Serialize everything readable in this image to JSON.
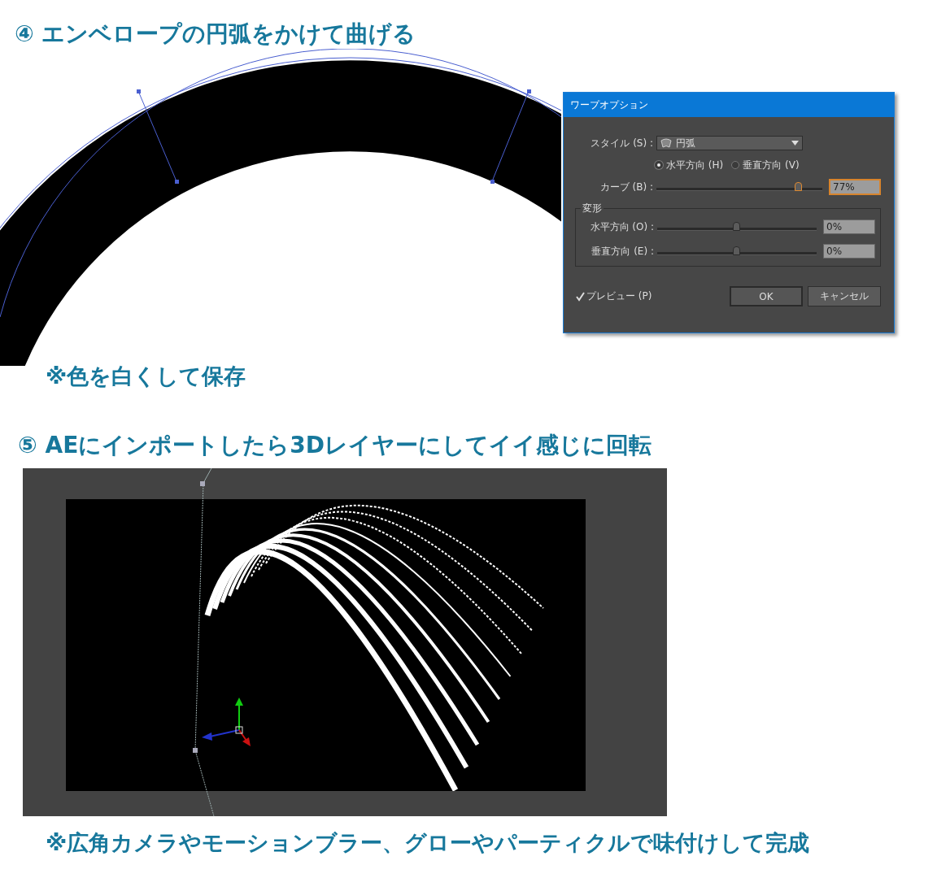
{
  "step_4": {
    "heading": "④ エンベロープの円弧をかけて曲げる",
    "note": "※色を白くして保存"
  },
  "dialog": {
    "title": "ワープオプション",
    "style": {
      "label": "スタイル (S) :",
      "value": "円弧"
    },
    "orientation": [
      {
        "label": "水平方向 (H)",
        "selected": true
      },
      {
        "label": "垂直方向 (V)",
        "selected": false
      }
    ],
    "curve": {
      "label": "カーブ (B) :",
      "level": 0.86,
      "value": "77%",
      "focused": true
    },
    "distortion": {
      "label": "変形",
      "sliders": [
        {
          "label": "水平方向 (O) :",
          "level": 0.5,
          "value": "0%",
          "focused": false
        },
        {
          "label": "垂直方向 (E) :",
          "level": 0.5,
          "value": "0%",
          "focused": false
        }
      ]
    },
    "preview": {
      "label": "プレビュー (P)",
      "checked": true
    },
    "buttons": [
      {
        "label": "OK",
        "default": true
      },
      {
        "label": "キャンセル",
        "default": false
      }
    ]
  },
  "step_5": {
    "heading": "⑤ AEにインポートしたら3Dレイヤーにしてイイ感じに回転",
    "note": "※広角カメラやモーションブラー、グローやパーティクルで味付けして完成"
  }
}
